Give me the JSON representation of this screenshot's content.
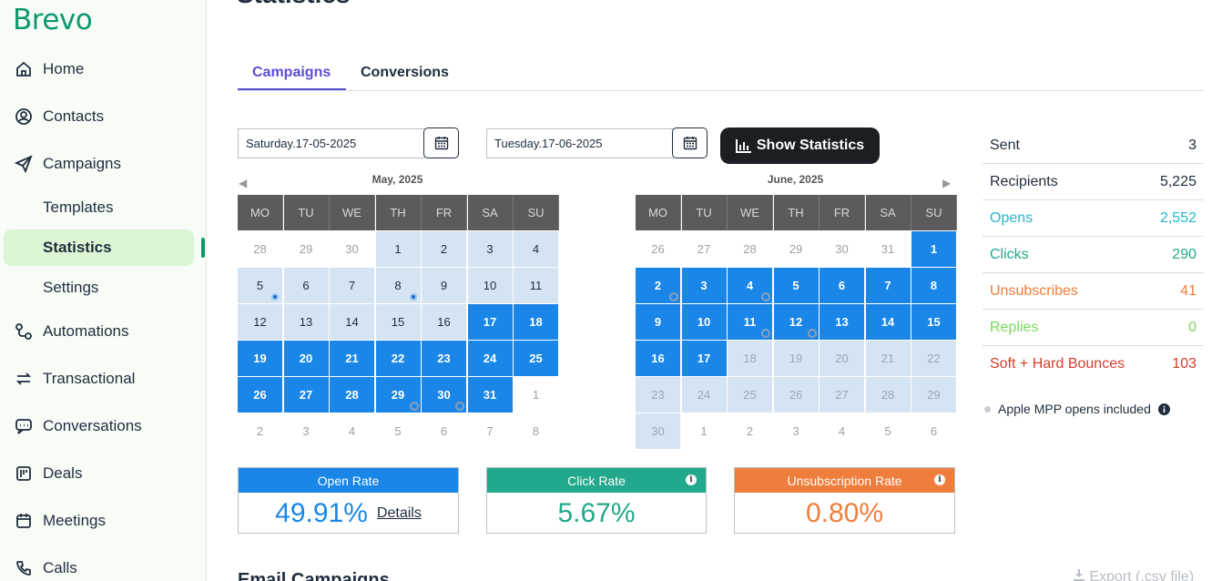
{
  "sidebar": {
    "logo": "Brevo",
    "items": [
      {
        "label": "Home",
        "icon": "home-icon"
      },
      {
        "label": "Contacts",
        "icon": "contacts-icon"
      },
      {
        "label": "Campaigns",
        "icon": "send-icon"
      },
      {
        "label": "Templates",
        "icon": ""
      },
      {
        "label": "Statistics",
        "icon": ""
      },
      {
        "label": "Settings",
        "icon": ""
      },
      {
        "label": "Automations",
        "icon": "automations-icon"
      },
      {
        "label": "Transactional",
        "icon": "transactional-icon"
      },
      {
        "label": "Conversations",
        "icon": "conversations-icon"
      },
      {
        "label": "Deals",
        "icon": "deals-icon"
      },
      {
        "label": "Meetings",
        "icon": "calendar-icon"
      },
      {
        "label": "Calls",
        "icon": "phone-icon"
      }
    ],
    "active": "Statistics",
    "accent": "#0b996e",
    "active_bg": "#dcf5d4"
  },
  "page": {
    "title": "Statistics",
    "tabs": [
      {
        "label": "Campaigns",
        "active": true
      },
      {
        "label": "Conversions",
        "active": false
      }
    ]
  },
  "filter": {
    "start_date": "Saturday.17-05-2025",
    "end_date": "Tuesday.17-06-2025",
    "show_button": "Show Statistics"
  },
  "calendars": {
    "weekdays": [
      "MO",
      "TU",
      "WE",
      "TH",
      "FR",
      "SA",
      "SU"
    ],
    "may": {
      "title": "May, 2025",
      "days": [
        {
          "n": "28",
          "s": "other"
        },
        {
          "n": "29",
          "s": "other"
        },
        {
          "n": "30",
          "s": "other"
        },
        {
          "n": "1",
          "s": "range"
        },
        {
          "n": "2",
          "s": "range"
        },
        {
          "n": "3",
          "s": "range"
        },
        {
          "n": "4",
          "s": "range"
        },
        {
          "n": "5",
          "s": "range",
          "dot": "fill"
        },
        {
          "n": "6",
          "s": "range"
        },
        {
          "n": "7",
          "s": "range"
        },
        {
          "n": "8",
          "s": "range",
          "dot": "fill"
        },
        {
          "n": "9",
          "s": "range"
        },
        {
          "n": "10",
          "s": "range"
        },
        {
          "n": "11",
          "s": "range"
        },
        {
          "n": "12",
          "s": "range"
        },
        {
          "n": "13",
          "s": "range"
        },
        {
          "n": "14",
          "s": "range"
        },
        {
          "n": "15",
          "s": "range"
        },
        {
          "n": "16",
          "s": "range"
        },
        {
          "n": "17",
          "s": "sel"
        },
        {
          "n": "18",
          "s": "sel"
        },
        {
          "n": "19",
          "s": "sel"
        },
        {
          "n": "20",
          "s": "sel"
        },
        {
          "n": "21",
          "s": "sel"
        },
        {
          "n": "22",
          "s": "sel"
        },
        {
          "n": "23",
          "s": "sel"
        },
        {
          "n": "24",
          "s": "sel"
        },
        {
          "n": "25",
          "s": "sel"
        },
        {
          "n": "26",
          "s": "sel"
        },
        {
          "n": "27",
          "s": "sel"
        },
        {
          "n": "28",
          "s": "sel"
        },
        {
          "n": "29",
          "s": "sel",
          "dot": "ring"
        },
        {
          "n": "30",
          "s": "sel",
          "dot": "ring"
        },
        {
          "n": "31",
          "s": "sel"
        },
        {
          "n": "1",
          "s": "other"
        },
        {
          "n": "2",
          "s": "other"
        },
        {
          "n": "3",
          "s": "other"
        },
        {
          "n": "4",
          "s": "other"
        },
        {
          "n": "5",
          "s": "other"
        },
        {
          "n": "6",
          "s": "other"
        },
        {
          "n": "7",
          "s": "other"
        },
        {
          "n": "8",
          "s": "other"
        }
      ]
    },
    "june": {
      "title": "June, 2025",
      "days": [
        {
          "n": "26",
          "s": "other"
        },
        {
          "n": "27",
          "s": "other"
        },
        {
          "n": "28",
          "s": "other"
        },
        {
          "n": "29",
          "s": "other"
        },
        {
          "n": "30",
          "s": "other"
        },
        {
          "n": "31",
          "s": "other"
        },
        {
          "n": "1",
          "s": "sel"
        },
        {
          "n": "2",
          "s": "sel",
          "dot": "ring"
        },
        {
          "n": "3",
          "s": "sel"
        },
        {
          "n": "4",
          "s": "sel",
          "dot": "ring"
        },
        {
          "n": "5",
          "s": "sel"
        },
        {
          "n": "6",
          "s": "sel"
        },
        {
          "n": "7",
          "s": "sel"
        },
        {
          "n": "8",
          "s": "sel"
        },
        {
          "n": "9",
          "s": "sel"
        },
        {
          "n": "10",
          "s": "sel"
        },
        {
          "n": "11",
          "s": "sel",
          "dot": "ring"
        },
        {
          "n": "12",
          "s": "sel",
          "dot": "ring"
        },
        {
          "n": "13",
          "s": "sel"
        },
        {
          "n": "14",
          "s": "sel"
        },
        {
          "n": "15",
          "s": "sel"
        },
        {
          "n": "16",
          "s": "sel"
        },
        {
          "n": "17",
          "s": "sel"
        },
        {
          "n": "18",
          "s": "dis"
        },
        {
          "n": "19",
          "s": "dis"
        },
        {
          "n": "20",
          "s": "dis"
        },
        {
          "n": "21",
          "s": "dis"
        },
        {
          "n": "22",
          "s": "dis"
        },
        {
          "n": "23",
          "s": "dis"
        },
        {
          "n": "24",
          "s": "dis"
        },
        {
          "n": "25",
          "s": "dis"
        },
        {
          "n": "26",
          "s": "dis"
        },
        {
          "n": "27",
          "s": "dis"
        },
        {
          "n": "28",
          "s": "dis"
        },
        {
          "n": "29",
          "s": "dis"
        },
        {
          "n": "30",
          "s": "dis"
        },
        {
          "n": "1",
          "s": "other"
        },
        {
          "n": "2",
          "s": "other"
        },
        {
          "n": "3",
          "s": "other"
        },
        {
          "n": "4",
          "s": "other"
        },
        {
          "n": "5",
          "s": "other"
        },
        {
          "n": "6",
          "s": "other"
        }
      ]
    }
  },
  "stats": [
    {
      "label": "Sent",
      "value": "3",
      "color": "#1f2d3d"
    },
    {
      "label": "Recipients",
      "value": "5,225",
      "color": "#1f2d3d"
    },
    {
      "label": "Opens",
      "value": "2,552",
      "color": "#22b8c9"
    },
    {
      "label": "Clicks",
      "value": "290",
      "color": "#22a88a"
    },
    {
      "label": "Unsubscribes",
      "value": "41",
      "color": "#ef7d3c"
    },
    {
      "label": "Replies",
      "value": "0",
      "color": "#7ad85a"
    },
    {
      "label": "Soft + Hard Bounces",
      "value": "103",
      "color": "#d83a2e"
    }
  ],
  "mpp_note": "Apple MPP opens included",
  "rates": {
    "open": {
      "label": "Open Rate",
      "value": "49.91%",
      "details": "Details",
      "color": "#1a86e8"
    },
    "click": {
      "label": "Click Rate",
      "value": "5.67%",
      "color": "#22a88a"
    },
    "unsub": {
      "label": "Unsubscription Rate",
      "value": "0.80%",
      "color": "#ef7d3c"
    }
  },
  "section": {
    "title": "Email Campaigns",
    "export": "Export (.csv file)"
  }
}
